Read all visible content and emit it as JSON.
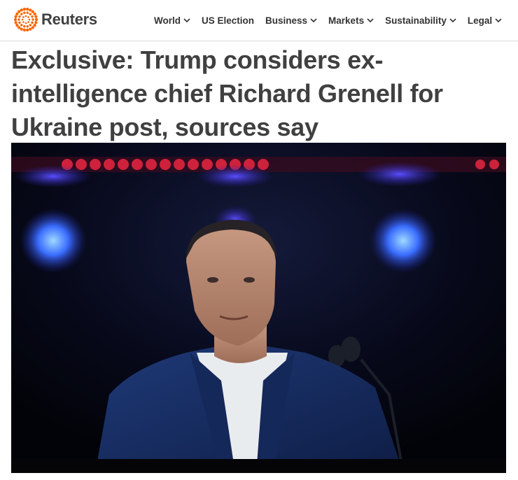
{
  "brand": {
    "name": "Reuters",
    "accent_color": "#fa6400",
    "text_color": "#404040"
  },
  "nav": {
    "items": [
      {
        "label": "World",
        "has_dropdown": true
      },
      {
        "label": "US Election",
        "has_dropdown": false
      },
      {
        "label": "Business",
        "has_dropdown": true
      },
      {
        "label": "Markets",
        "has_dropdown": true
      },
      {
        "label": "Sustainability",
        "has_dropdown": true
      },
      {
        "label": "Legal",
        "has_dropdown": true
      }
    ]
  },
  "article": {
    "headline": "Exclusive: Trump considers ex-intelligence chief Richard Grenell for Ukraine post, sources say",
    "hero_image": {
      "icon": "photo",
      "background_color": "#05060c"
    }
  }
}
